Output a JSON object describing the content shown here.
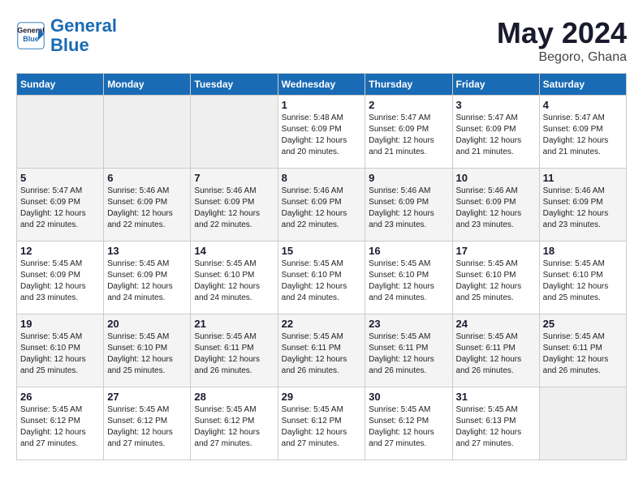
{
  "header": {
    "logo_general": "General",
    "logo_blue": "Blue",
    "month_year": "May 2024",
    "location": "Begoro, Ghana"
  },
  "weekdays": [
    "Sunday",
    "Monday",
    "Tuesday",
    "Wednesday",
    "Thursday",
    "Friday",
    "Saturday"
  ],
  "weeks": [
    [
      {
        "date": "",
        "sunrise": "",
        "sunset": "",
        "daylight": ""
      },
      {
        "date": "",
        "sunrise": "",
        "sunset": "",
        "daylight": ""
      },
      {
        "date": "",
        "sunrise": "",
        "sunset": "",
        "daylight": ""
      },
      {
        "date": "1",
        "sunrise": "Sunrise: 5:48 AM",
        "sunset": "Sunset: 6:09 PM",
        "daylight": "Daylight: 12 hours and 20 minutes."
      },
      {
        "date": "2",
        "sunrise": "Sunrise: 5:47 AM",
        "sunset": "Sunset: 6:09 PM",
        "daylight": "Daylight: 12 hours and 21 minutes."
      },
      {
        "date": "3",
        "sunrise": "Sunrise: 5:47 AM",
        "sunset": "Sunset: 6:09 PM",
        "daylight": "Daylight: 12 hours and 21 minutes."
      },
      {
        "date": "4",
        "sunrise": "Sunrise: 5:47 AM",
        "sunset": "Sunset: 6:09 PM",
        "daylight": "Daylight: 12 hours and 21 minutes."
      }
    ],
    [
      {
        "date": "5",
        "sunrise": "Sunrise: 5:47 AM",
        "sunset": "Sunset: 6:09 PM",
        "daylight": "Daylight: 12 hours and 22 minutes."
      },
      {
        "date": "6",
        "sunrise": "Sunrise: 5:46 AM",
        "sunset": "Sunset: 6:09 PM",
        "daylight": "Daylight: 12 hours and 22 minutes."
      },
      {
        "date": "7",
        "sunrise": "Sunrise: 5:46 AM",
        "sunset": "Sunset: 6:09 PM",
        "daylight": "Daylight: 12 hours and 22 minutes."
      },
      {
        "date": "8",
        "sunrise": "Sunrise: 5:46 AM",
        "sunset": "Sunset: 6:09 PM",
        "daylight": "Daylight: 12 hours and 22 minutes."
      },
      {
        "date": "9",
        "sunrise": "Sunrise: 5:46 AM",
        "sunset": "Sunset: 6:09 PM",
        "daylight": "Daylight: 12 hours and 23 minutes."
      },
      {
        "date": "10",
        "sunrise": "Sunrise: 5:46 AM",
        "sunset": "Sunset: 6:09 PM",
        "daylight": "Daylight: 12 hours and 23 minutes."
      },
      {
        "date": "11",
        "sunrise": "Sunrise: 5:46 AM",
        "sunset": "Sunset: 6:09 PM",
        "daylight": "Daylight: 12 hours and 23 minutes."
      }
    ],
    [
      {
        "date": "12",
        "sunrise": "Sunrise: 5:45 AM",
        "sunset": "Sunset: 6:09 PM",
        "daylight": "Daylight: 12 hours and 23 minutes."
      },
      {
        "date": "13",
        "sunrise": "Sunrise: 5:45 AM",
        "sunset": "Sunset: 6:09 PM",
        "daylight": "Daylight: 12 hours and 24 minutes."
      },
      {
        "date": "14",
        "sunrise": "Sunrise: 5:45 AM",
        "sunset": "Sunset: 6:10 PM",
        "daylight": "Daylight: 12 hours and 24 minutes."
      },
      {
        "date": "15",
        "sunrise": "Sunrise: 5:45 AM",
        "sunset": "Sunset: 6:10 PM",
        "daylight": "Daylight: 12 hours and 24 minutes."
      },
      {
        "date": "16",
        "sunrise": "Sunrise: 5:45 AM",
        "sunset": "Sunset: 6:10 PM",
        "daylight": "Daylight: 12 hours and 24 minutes."
      },
      {
        "date": "17",
        "sunrise": "Sunrise: 5:45 AM",
        "sunset": "Sunset: 6:10 PM",
        "daylight": "Daylight: 12 hours and 25 minutes."
      },
      {
        "date": "18",
        "sunrise": "Sunrise: 5:45 AM",
        "sunset": "Sunset: 6:10 PM",
        "daylight": "Daylight: 12 hours and 25 minutes."
      }
    ],
    [
      {
        "date": "19",
        "sunrise": "Sunrise: 5:45 AM",
        "sunset": "Sunset: 6:10 PM",
        "daylight": "Daylight: 12 hours and 25 minutes."
      },
      {
        "date": "20",
        "sunrise": "Sunrise: 5:45 AM",
        "sunset": "Sunset: 6:10 PM",
        "daylight": "Daylight: 12 hours and 25 minutes."
      },
      {
        "date": "21",
        "sunrise": "Sunrise: 5:45 AM",
        "sunset": "Sunset: 6:11 PM",
        "daylight": "Daylight: 12 hours and 26 minutes."
      },
      {
        "date": "22",
        "sunrise": "Sunrise: 5:45 AM",
        "sunset": "Sunset: 6:11 PM",
        "daylight": "Daylight: 12 hours and 26 minutes."
      },
      {
        "date": "23",
        "sunrise": "Sunrise: 5:45 AM",
        "sunset": "Sunset: 6:11 PM",
        "daylight": "Daylight: 12 hours and 26 minutes."
      },
      {
        "date": "24",
        "sunrise": "Sunrise: 5:45 AM",
        "sunset": "Sunset: 6:11 PM",
        "daylight": "Daylight: 12 hours and 26 minutes."
      },
      {
        "date": "25",
        "sunrise": "Sunrise: 5:45 AM",
        "sunset": "Sunset: 6:11 PM",
        "daylight": "Daylight: 12 hours and 26 minutes."
      }
    ],
    [
      {
        "date": "26",
        "sunrise": "Sunrise: 5:45 AM",
        "sunset": "Sunset: 6:12 PM",
        "daylight": "Daylight: 12 hours and 27 minutes."
      },
      {
        "date": "27",
        "sunrise": "Sunrise: 5:45 AM",
        "sunset": "Sunset: 6:12 PM",
        "daylight": "Daylight: 12 hours and 27 minutes."
      },
      {
        "date": "28",
        "sunrise": "Sunrise: 5:45 AM",
        "sunset": "Sunset: 6:12 PM",
        "daylight": "Daylight: 12 hours and 27 minutes."
      },
      {
        "date": "29",
        "sunrise": "Sunrise: 5:45 AM",
        "sunset": "Sunset: 6:12 PM",
        "daylight": "Daylight: 12 hours and 27 minutes."
      },
      {
        "date": "30",
        "sunrise": "Sunrise: 5:45 AM",
        "sunset": "Sunset: 6:12 PM",
        "daylight": "Daylight: 12 hours and 27 minutes."
      },
      {
        "date": "31",
        "sunrise": "Sunrise: 5:45 AM",
        "sunset": "Sunset: 6:13 PM",
        "daylight": "Daylight: 12 hours and 27 minutes."
      },
      {
        "date": "",
        "sunrise": "",
        "sunset": "",
        "daylight": ""
      }
    ]
  ]
}
